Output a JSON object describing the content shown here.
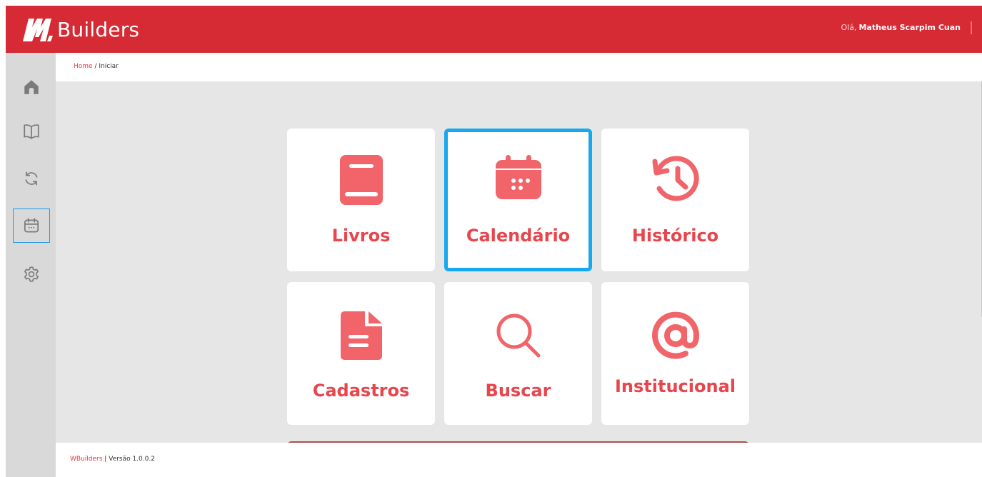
{
  "app": {
    "brand_name": "Builders",
    "brand_color": "#d62b35",
    "accent_color": "#e8454d",
    "selection_color": "#18a8ef"
  },
  "header": {
    "greeting": "Olá,",
    "user_name": "Matheus Scarpim Cuan"
  },
  "breadcrumb": {
    "home": "Home",
    "separator": "/",
    "current": "Iniciar"
  },
  "sidebar": {
    "items": [
      {
        "icon": "home-icon",
        "active": false
      },
      {
        "icon": "book-open-icon",
        "active": false
      },
      {
        "icon": "refresh-icon",
        "active": false
      },
      {
        "icon": "calendar-icon",
        "active": true
      },
      {
        "icon": "gear-icon",
        "active": false
      }
    ]
  },
  "tiles": [
    {
      "label": "Livros",
      "icon": "book-icon"
    },
    {
      "label": "Calendário",
      "icon": "calendar-icon",
      "selected": true
    },
    {
      "label": "Histórico",
      "icon": "history-icon"
    },
    {
      "label": "Cadastros",
      "icon": "document-icon"
    },
    {
      "label": "Buscar",
      "icon": "search-icon"
    },
    {
      "label": "Institucional",
      "icon": "at-sign-icon"
    }
  ],
  "footer": {
    "brand": "WBuilders",
    "version_text": "| Versão 1.0.0.2"
  }
}
